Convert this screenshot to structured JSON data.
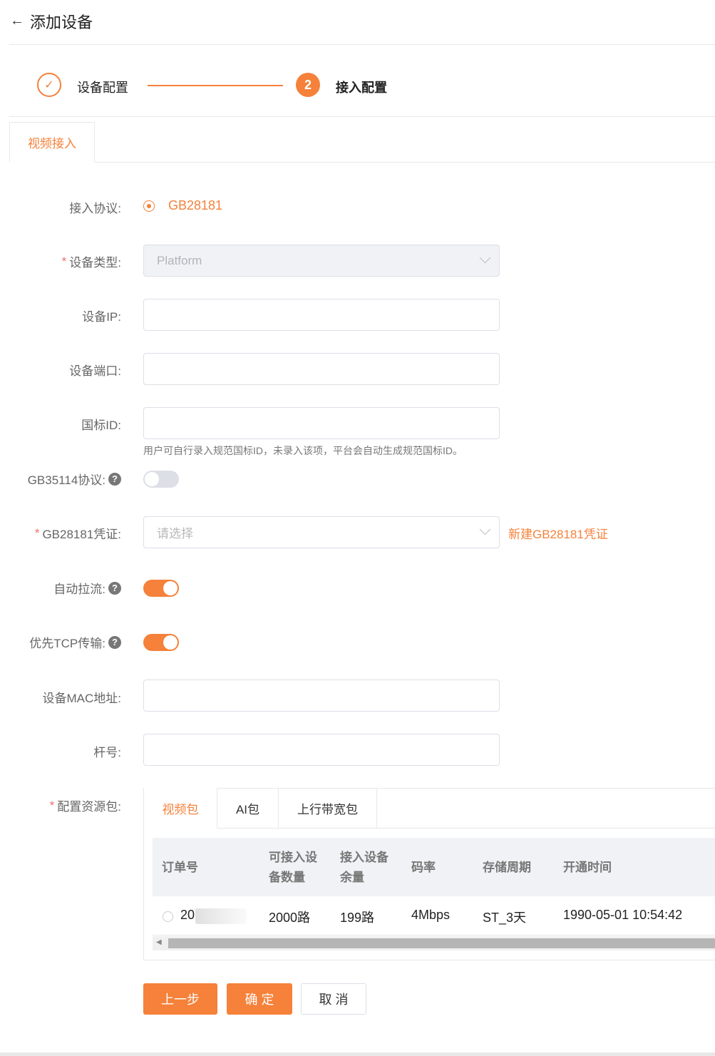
{
  "header": {
    "back_icon": "arrow-left-icon",
    "title": "添加设备"
  },
  "steps": [
    {
      "label": "设备配置",
      "status": "done",
      "icon": "check-icon"
    },
    {
      "number": "2",
      "label": "接入配置",
      "status": "active"
    }
  ],
  "tabs": {
    "video_access": "视频接入"
  },
  "form": {
    "protocol": {
      "label": "接入协议:",
      "option": "GB28181"
    },
    "device_type": {
      "label": "设备类型:",
      "value": "Platform"
    },
    "device_ip": {
      "label": "设备IP:"
    },
    "device_port": {
      "label": "设备端口:"
    },
    "gb_id": {
      "label": "国标ID:",
      "hint": "用户可自行录入规范国标ID，未录入该项，平台会自动生成规范国标ID。"
    },
    "gb35114": {
      "label": "GB35114协议:",
      "enabled": false
    },
    "credential": {
      "label": "GB28181凭证:",
      "placeholder": "请选择",
      "new_link": "新建GB28181凭证"
    },
    "auto_pull": {
      "label": "自动拉流:",
      "enabled": true
    },
    "tcp_first": {
      "label": "优先TCP传输:",
      "enabled": true
    },
    "mac": {
      "label": "设备MAC地址:"
    },
    "pole": {
      "label": "杆号:"
    },
    "resource_pack": {
      "label": "配置资源包:"
    }
  },
  "resource_tabs": [
    "视频包",
    "AI包",
    "上行带宽包"
  ],
  "table": {
    "headers": [
      "订单号",
      "可接入设\n备数量",
      "接入设备\n余量",
      "码率",
      "存储周期",
      "开通时间"
    ],
    "rows": [
      {
        "order": "20",
        "capacity": "2000路",
        "remaining": "199路",
        "bitrate": "4Mbps",
        "storage": "ST_3天",
        "opened": "1990-05-01 10:54:42"
      }
    ]
  },
  "buttons": {
    "prev": "上一步",
    "confirm": "确 定",
    "cancel": "取 消"
  },
  "colors": {
    "accent": "#f5813a",
    "required": "#f56c6c"
  }
}
